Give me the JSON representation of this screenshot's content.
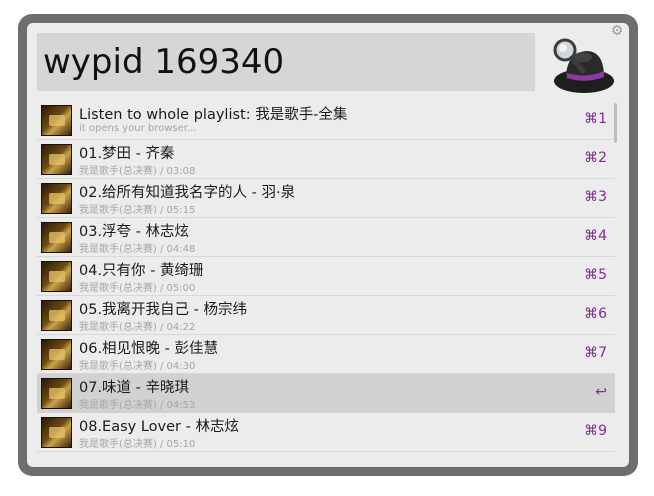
{
  "search": {
    "query": "wypid 169340"
  },
  "icons": {
    "gear": "gear-icon",
    "logo": "hat-and-magnifier-logo"
  },
  "colors": {
    "shortcut": "#7e2c8f",
    "selected_row": "#d1d1d1"
  },
  "results": [
    {
      "title": "Listen to whole playlist: 我是歌手-全集",
      "subtitle": "it opens your browser...",
      "shortcut": "⌘1"
    },
    {
      "title": "01.梦田 - 齐秦",
      "subtitle": "我是歌手(总决赛) / 03:08",
      "shortcut": "⌘2"
    },
    {
      "title": "02.给所有知道我名字的人 - 羽·泉",
      "subtitle": "我是歌手(总决赛) / 05:15",
      "shortcut": "⌘3"
    },
    {
      "title": "03.浮夸 - 林志炫",
      "subtitle": "我是歌手(总决赛) / 04:48",
      "shortcut": "⌘4"
    },
    {
      "title": "04.只有你 - 黄绮珊",
      "subtitle": "我是歌手(总决赛) / 05:00",
      "shortcut": "⌘5"
    },
    {
      "title": "05.我离开我自己 - 杨宗纬",
      "subtitle": "我是歌手(总决赛) / 04:22",
      "shortcut": "⌘6"
    },
    {
      "title": "06.相见恨晚 - 彭佳慧",
      "subtitle": "我是歌手(总决赛) / 04:30",
      "shortcut": "⌘7"
    },
    {
      "title": "07.味道 - 辛晓琪",
      "subtitle": "我是歌手(总决赛) / 04:53",
      "shortcut": "↩"
    },
    {
      "title": "08.Easy Lover - 林志炫",
      "subtitle": "我是歌手(总决赛) / 05:10",
      "shortcut": "⌘9"
    }
  ]
}
